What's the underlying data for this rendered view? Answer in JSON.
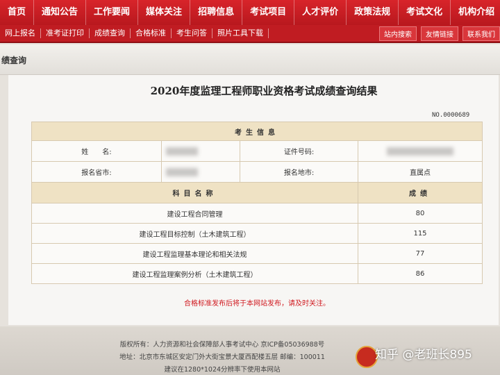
{
  "topnav": [
    "首页",
    "通知公告",
    "工作要闻",
    "媒体关注",
    "招聘信息",
    "考试项目",
    "人才评价",
    "政策法规",
    "考试文化",
    "机构介绍"
  ],
  "subnav": {
    "items": [
      "网上报名",
      "准考证打印",
      "成绩查询",
      "合格标准",
      "考生问答",
      "照片工具下载"
    ],
    "search": "站内搜索",
    "links": "友情链接",
    "contact": "联系我们"
  },
  "breadcrumb": "绩查询",
  "page": {
    "title": "2020年度监理工程师职业资格考试成绩查询结果",
    "serial": "NO.0000689"
  },
  "candidate": {
    "section_title": "考生信息",
    "name_label": "姓　　名:",
    "id_label": "证件号码:",
    "province_label": "报名省市:",
    "site_label": "报名地市:",
    "site_value": "直属点"
  },
  "scores": {
    "subject_header": "科目名称",
    "score_header": "成绩",
    "rows": [
      {
        "subject": "建设工程合同管理",
        "score": "80"
      },
      {
        "subject": "建设工程目标控制（土木建筑工程）",
        "score": "115"
      },
      {
        "subject": "建设工程监理基本理论和相关法规",
        "score": "77"
      },
      {
        "subject": "建设工程监理案例分析（土木建筑工程）",
        "score": "86"
      }
    ]
  },
  "notice": "合格标准发布后将于本网站发布，请及时关注。",
  "footer": {
    "copyright": "版权所有：人力资源和社会保障部人事考试中心 京ICP备05036988号",
    "address": "地址：北京市东城区安定门外大街宝景大厦西配楼五层 邮编：100011",
    "suggestion": "建议在1280*1024分辨率下使用本网站"
  },
  "watermark": "知乎 @老班长895",
  "colors": {
    "nav_red": "#d8242a",
    "header_tan": "#efe2c4",
    "notice_red": "#d0191f"
  }
}
